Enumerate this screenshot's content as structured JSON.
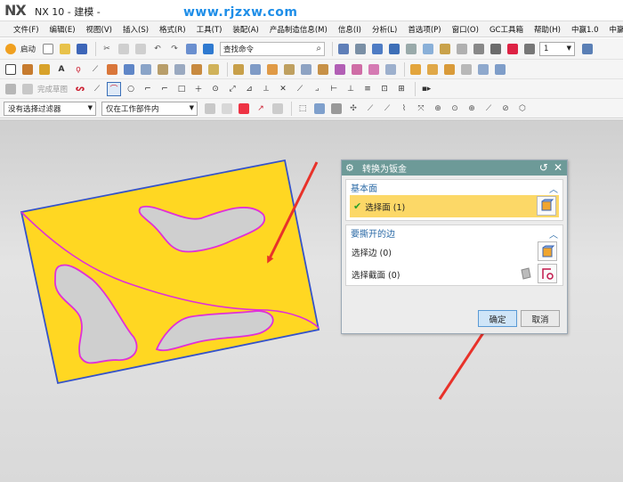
{
  "app": {
    "logo": "NX",
    "title": "NX 10 - 建模 -",
    "watermark": "www.rjzxw.com"
  },
  "menu": [
    "文件(F)",
    "编辑(E)",
    "视图(V)",
    "插入(S)",
    "格式(R)",
    "工具(T)",
    "装配(A)",
    "产品制造信息(M)",
    "信息(I)",
    "分析(L)",
    "首选项(P)",
    "窗口(O)",
    "GC工具箱",
    "帮助(H)",
    "中赢1.0",
    "中赢教程"
  ],
  "toolbar1": {
    "start_label": "启动",
    "search_placeholder": "查找命令",
    "count_value": "1"
  },
  "toolbar3": {
    "finish_sketch": "完成草图"
  },
  "toolbar4": {
    "filter_value": "没有选择过滤器",
    "scope_value": "仅在工作部件内"
  },
  "colors": {
    "part_fill": "#ffd722",
    "part_edge": "#3553c9",
    "cutout_edge": "#e030d8",
    "cutout_fill": "#cfcfcf",
    "arrow": "#e8322a",
    "dialog_title": "#6d9a98"
  },
  "dialog": {
    "title": "转换为钣金",
    "base_group": {
      "label": "基本面",
      "select_face": "选择面 (1)"
    },
    "rip_group": {
      "label": "要撕开的边",
      "select_edge": "选择边 (0)",
      "select_section": "选择截面 (0)"
    },
    "ok": "确定",
    "cancel": "取消"
  }
}
